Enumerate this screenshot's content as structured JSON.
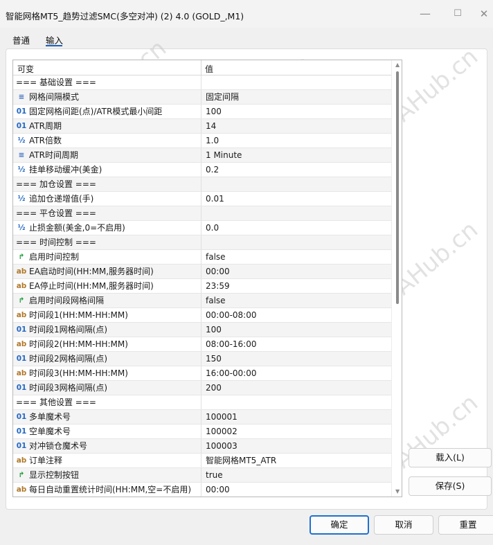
{
  "window": {
    "title": "智能网格MT5_趋势过滤SMC(多空对冲) (2) 4.0 (GOLD_,M1)",
    "minimize_glyph": "—",
    "maximize_glyph": "☐",
    "close_glyph": "✕"
  },
  "tabs": [
    {
      "label": "普通",
      "active": false
    },
    {
      "label": "输入",
      "active": true
    }
  ],
  "table": {
    "columns": [
      "可变",
      "值"
    ],
    "rows": [
      {
        "type": "section",
        "name": "=== 基础设置 ===",
        "value": ""
      },
      {
        "type": "enum",
        "icon": "enum-icon",
        "glyph": "≡",
        "name": "网格间隔模式",
        "value": "固定间隔"
      },
      {
        "type": "int",
        "icon": "integer-icon",
        "glyph": "01",
        "name": "固定网格间距(点)/ATR模式最小间距",
        "value": "100"
      },
      {
        "type": "int",
        "icon": "integer-icon",
        "glyph": "01",
        "name": "ATR周期",
        "value": "14"
      },
      {
        "type": "double",
        "icon": "double-icon",
        "glyph": "½",
        "name": "ATR倍数",
        "value": "1.0"
      },
      {
        "type": "enum",
        "icon": "enum-icon",
        "glyph": "≡",
        "name": "ATR时间周期",
        "value": "1 Minute"
      },
      {
        "type": "double",
        "icon": "double-icon",
        "glyph": "½",
        "name": "挂单移动缓冲(美金)",
        "value": "0.2"
      },
      {
        "type": "section",
        "name": "=== 加仓设置 ===",
        "value": ""
      },
      {
        "type": "double",
        "icon": "double-icon",
        "glyph": "½",
        "name": "追加仓递增值(手)",
        "value": "0.01"
      },
      {
        "type": "section",
        "name": "=== 平仓设置 ===",
        "value": ""
      },
      {
        "type": "double",
        "icon": "double-icon",
        "glyph": "½",
        "name": "止损金额(美金,0=不启用)",
        "value": "0.0"
      },
      {
        "type": "section",
        "name": "=== 时间控制 ===",
        "value": ""
      },
      {
        "type": "bool",
        "icon": "boolean-icon",
        "glyph": "↱",
        "name": "启用时间控制",
        "value": "false"
      },
      {
        "type": "string",
        "icon": "string-icon",
        "glyph": "ab",
        "name": "EA启动时间(HH:MM,服务器时间)",
        "value": "00:00"
      },
      {
        "type": "string",
        "icon": "string-icon",
        "glyph": "ab",
        "name": "EA停止时间(HH:MM,服务器时间)",
        "value": "23:59"
      },
      {
        "type": "bool",
        "icon": "boolean-icon",
        "glyph": "↱",
        "name": "启用时间段网格间隔",
        "value": "false"
      },
      {
        "type": "string",
        "icon": "string-icon",
        "glyph": "ab",
        "name": "时间段1(HH:MM-HH:MM)",
        "value": "00:00-08:00"
      },
      {
        "type": "int",
        "icon": "integer-icon",
        "glyph": "01",
        "name": "时间段1网格间隔(点)",
        "value": "100"
      },
      {
        "type": "string",
        "icon": "string-icon",
        "glyph": "ab",
        "name": "时间段2(HH:MM-HH:MM)",
        "value": "08:00-16:00"
      },
      {
        "type": "int",
        "icon": "integer-icon",
        "glyph": "01",
        "name": "时间段2网格间隔(点)",
        "value": "150"
      },
      {
        "type": "string",
        "icon": "string-icon",
        "glyph": "ab",
        "name": "时间段3(HH:MM-HH:MM)",
        "value": "16:00-00:00"
      },
      {
        "type": "int",
        "icon": "integer-icon",
        "glyph": "01",
        "name": "时间段3网格间隔(点)",
        "value": "200"
      },
      {
        "type": "section",
        "name": "=== 其他设置 ===",
        "value": ""
      },
      {
        "type": "int",
        "icon": "integer-icon",
        "glyph": "01",
        "name": "多单魔术号",
        "value": "100001"
      },
      {
        "type": "int",
        "icon": "integer-icon",
        "glyph": "01",
        "name": "空单魔术号",
        "value": "100002"
      },
      {
        "type": "int",
        "icon": "integer-icon",
        "glyph": "01",
        "name": "对冲锁仓魔术号",
        "value": "100003"
      },
      {
        "type": "string",
        "icon": "string-icon",
        "glyph": "ab",
        "name": "订单注释",
        "value": "智能网格MT5_ATR"
      },
      {
        "type": "bool",
        "icon": "boolean-icon",
        "glyph": "↱",
        "name": "显示控制按钮",
        "value": "true"
      },
      {
        "type": "string",
        "icon": "string-icon",
        "glyph": "ab",
        "name": "每日自动重置统计时间(HH:MM,空=不启用)",
        "value": "00:00"
      }
    ]
  },
  "buttons": {
    "load": "载入(L)",
    "save": "保存(S)",
    "ok": "确定",
    "cancel": "取消",
    "reset": "重置"
  },
  "watermark": "EAHub.cn",
  "colors": {
    "accent": "#1f6fd0",
    "bool_icon": "#1f9a3a",
    "string_icon": "#b0782a",
    "number_icon": "#2468c4"
  }
}
